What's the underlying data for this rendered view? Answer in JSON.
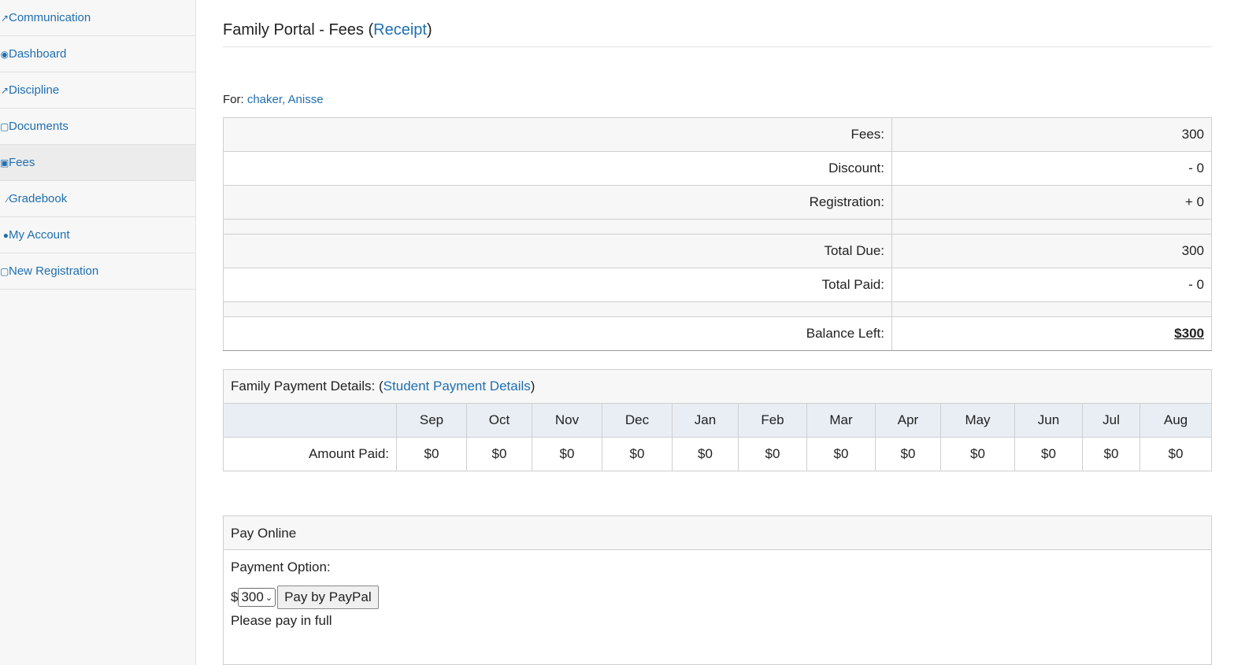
{
  "sidebar": {
    "items": [
      {
        "label": "Communication",
        "icon": "megaphone-icon"
      },
      {
        "label": "Dashboard",
        "icon": "dashboard-icon"
      },
      {
        "label": "Discipline",
        "icon": "gavel-icon"
      },
      {
        "label": "Documents",
        "icon": "document-icon"
      },
      {
        "label": "Fees",
        "icon": "money-icon",
        "active": true
      },
      {
        "label": "Gradebook",
        "icon": "book-icon"
      },
      {
        "label": "My Account",
        "icon": "user-icon"
      },
      {
        "label": "New Registration",
        "icon": "form-icon"
      }
    ]
  },
  "header": {
    "title_prefix": "Family Portal - Fees (",
    "receipt_link": "Receipt",
    "title_suffix": ")"
  },
  "for_line": {
    "label": "For:",
    "student": "chaker, Anisse"
  },
  "fees": {
    "rows": [
      {
        "label": "Fees:",
        "value": "300"
      },
      {
        "label": "Discount:",
        "value": "- 0"
      },
      {
        "label": "Registration:",
        "value": "+ 0"
      },
      {
        "label": "Total Due:",
        "value": "300"
      },
      {
        "label": "Total Paid:",
        "value": "- 0"
      },
      {
        "label": "Balance Left:",
        "value": "$300"
      }
    ]
  },
  "payment_details": {
    "caption_prefix": "Family Payment Details: (",
    "student_link": "Student Payment Details",
    "caption_suffix": ")",
    "months": [
      "Sep",
      "Oct",
      "Nov",
      "Dec",
      "Jan",
      "Feb",
      "Mar",
      "Apr",
      "May",
      "Jun",
      "Jul",
      "Aug"
    ],
    "row_label": "Amount Paid:",
    "amounts": [
      "$0",
      "$0",
      "$0",
      "$0",
      "$0",
      "$0",
      "$0",
      "$0",
      "$0",
      "$0",
      "$0",
      "$0"
    ]
  },
  "pay_online": {
    "title": "Pay Online",
    "option_label": "Payment Option:",
    "currency": "$",
    "selected_amount": "300",
    "button": "Pay by PayPal",
    "note": "Please pay in full"
  }
}
